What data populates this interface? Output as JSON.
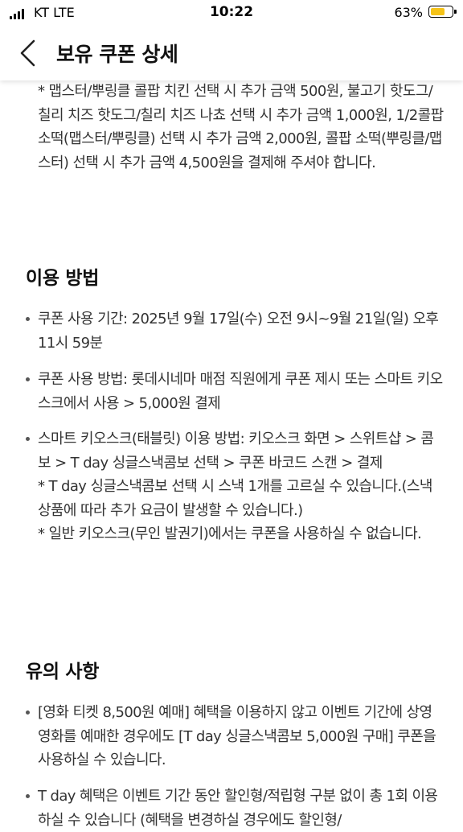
{
  "status": {
    "carrier": "KT  LTE",
    "time": "10:22",
    "battery": "63%"
  },
  "header": {
    "title": "보유 쿠폰 상세"
  },
  "top_note": "* 맵스터/뿌링클 콜팝 치킨 선택 시 추가 금액 500원, 불고기 핫도그/칠리 치즈 핫도그/칠리 치즈 나쵸 선택 시 추가 금액 1,000원, 1/2콜팝 소떡(맵스터/뿌링클) 선택 시 추가 금액 2,000원, 콜팝 소떡(뿌링클/맵스터) 선택 시 추가 금액 4,500원을 결제해 주셔야 합니다.",
  "usage": {
    "title": "이용 방법",
    "items": [
      "쿠폰 사용 기간: 2025년 9월 17일(수) 오전 9시~9월 21일(일) 오후 11시 59분",
      "쿠폰 사용 방법: 롯데시네마 매점 직원에게 쿠폰 제시 또는 스마트 키오스크에서 사용 > 5,000원 결제",
      "스마트 키오스크(태블릿) 이용 방법: 키오스크 화면 > 스위트샵 > 콤보 > T day 싱글스낵콤보 선택 > 쿠폰 바코드 스캔 > 결제"
    ],
    "notes": [
      "* T day 싱글스낵콤보 선택 시 스낵 1개를 고르실 수 있습니다.(스낵 상품에 따라 추가 요금이 발생할 수 있습니다.)",
      "* 일반 키오스크(무인 발권기)에서는 쿠폰을 사용하실 수 없습니다."
    ]
  },
  "caution": {
    "title": "유의 사항",
    "items": [
      "[영화 티켓 8,500원 예매] 혜택을 이용하지 않고 이벤트 기간에 상영 영화를 예매한 경우에도 [T day 싱글스낵콤보 5,000원 구매] 쿠폰을 사용하실 수 있습니다.",
      "T day 혜택은 이벤트 기간 동안 할인형/적립형 구분 없이 총 1회 이용하실 수 있습니다 (혜택을 변경하실 경우에도 할인형/"
    ]
  }
}
